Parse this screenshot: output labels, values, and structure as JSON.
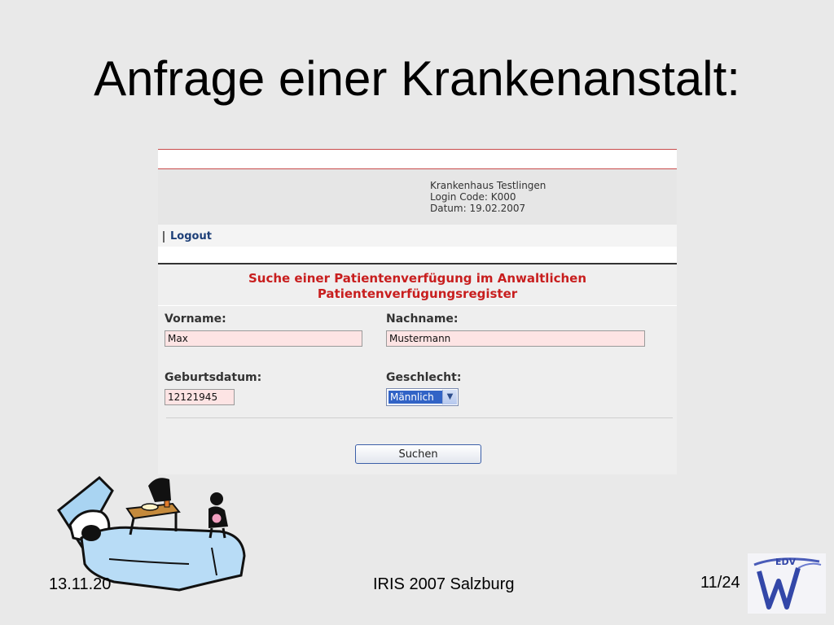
{
  "slide": {
    "title": "Anfrage einer Krankenanstalt:"
  },
  "hospital": {
    "name": "Krankenhaus Testlingen",
    "login_code": "Login Code: K000",
    "date": "Datum: 19.02.2007"
  },
  "nav": {
    "logout_label": "Logout"
  },
  "search": {
    "title_line1": "Suche einer Patientenverfügung im Anwaltlichen",
    "title_line2": "Patientenverfügungsregister"
  },
  "form": {
    "vorname_label": "Vorname:",
    "vorname_value": "Max",
    "nachname_label": "Nachname:",
    "nachname_value": "Mustermann",
    "geburtsdatum_label": "Geburtsdatum:",
    "geburtsdatum_value": "12121945",
    "geschlecht_label": "Geschlecht:",
    "geschlecht_value": "Männlich",
    "submit_label": "Suchen"
  },
  "footer": {
    "date": "13.11.20",
    "conference": "IRIS 2007 Salzburg",
    "page": "11/24"
  },
  "logo": {
    "text": "EDV",
    "letter": "W"
  },
  "colors": {
    "background": "#e9e9e9",
    "title_red": "#c81e1e",
    "link_blue": "#1d3f78",
    "input_pink": "#fde4e4",
    "select_blue": "#3163c6"
  }
}
